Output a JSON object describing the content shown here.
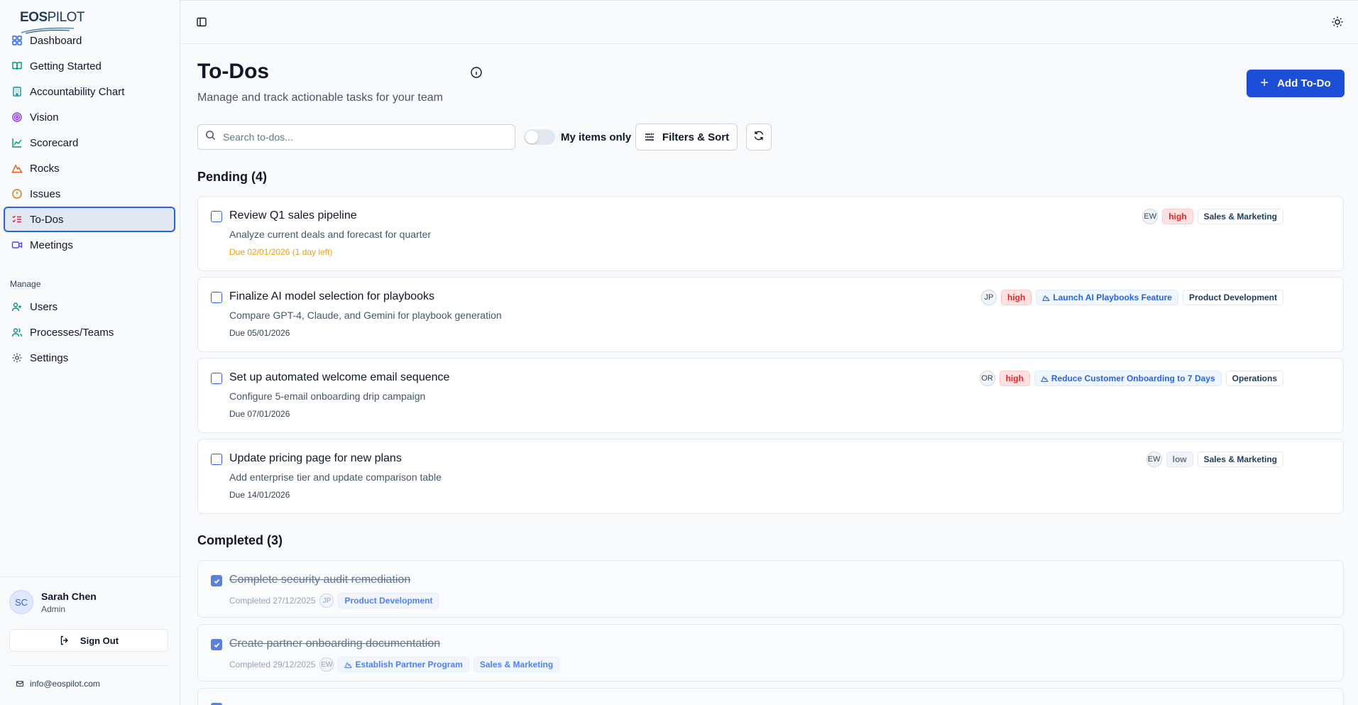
{
  "app": {
    "logo_bold": "EOS",
    "logo_light": "PILOT"
  },
  "sidebar": {
    "items": [
      {
        "label": "Dashboard",
        "icon": "dashboard-icon",
        "color": "#2563eb"
      },
      {
        "label": "Getting Started",
        "icon": "book-open-icon",
        "color": "#059669"
      },
      {
        "label": "Accountability Chart",
        "icon": "building-icon",
        "color": "#0891b2"
      },
      {
        "label": "Vision",
        "icon": "target-icon",
        "color": "#9333ea"
      },
      {
        "label": "Scorecard",
        "icon": "chart-line-icon",
        "color": "#059669"
      },
      {
        "label": "Rocks",
        "icon": "mountain-icon",
        "color": "#ea580c"
      },
      {
        "label": "Issues",
        "icon": "alert-circle-icon",
        "color": "#d97706"
      },
      {
        "label": "To-Dos",
        "icon": "list-todo-icon",
        "color": "#e11d48"
      },
      {
        "label": "Meetings",
        "icon": "video-icon",
        "color": "#4f46e5"
      }
    ],
    "manage_label": "Manage",
    "manage_items": [
      {
        "label": "Users",
        "icon": "users-icon",
        "color": "#0d9488"
      },
      {
        "label": "Processes/Teams",
        "icon": "teams-icon",
        "color": "#0d9488"
      },
      {
        "label": "Settings",
        "icon": "gear-icon",
        "color": "#475569"
      }
    ],
    "user": {
      "initials": "SC",
      "name": "Sarah Chen",
      "role": "Admin"
    },
    "sign_out": "Sign Out",
    "email": "info@eospilot.com"
  },
  "header": {
    "title": "To-Dos",
    "subtitle": "Manage and track actionable tasks for your team",
    "add_button": "Add To-Do"
  },
  "toolbar": {
    "search_placeholder": "Search to-dos...",
    "my_items_label": "My items only",
    "my_items_on": false,
    "filters_label": "Filters & Sort"
  },
  "pending": {
    "heading": "Pending (4)",
    "items": [
      {
        "title": "Review Q1 sales pipeline",
        "description": "Analyze current deals and forecast for quarter",
        "due": "Due 02/01/2026 (1 day left)",
        "due_warning": true,
        "assignee": "EW",
        "priority": "high",
        "rock": "",
        "team": "Sales & Marketing"
      },
      {
        "title": "Finalize AI model selection for playbooks",
        "description": "Compare GPT-4, Claude, and Gemini for playbook generation",
        "due": "Due 05/01/2026",
        "due_warning": false,
        "assignee": "JP",
        "priority": "high",
        "rock": "Launch AI Playbooks Feature",
        "team": "Product Development"
      },
      {
        "title": "Set up automated welcome email sequence",
        "description": "Configure 5-email onboarding drip campaign",
        "due": "Due 07/01/2026",
        "due_warning": false,
        "assignee": "OR",
        "priority": "high",
        "rock": "Reduce Customer Onboarding to 7 Days",
        "team": "Operations"
      },
      {
        "title": "Update pricing page for new plans",
        "description": "Add enterprise tier and update comparison table",
        "due": "Due 14/01/2026",
        "due_warning": false,
        "assignee": "EW",
        "priority": "low",
        "rock": "",
        "team": "Sales & Marketing"
      }
    ]
  },
  "completed": {
    "heading": "Completed (3)",
    "items": [
      {
        "title": "Complete security audit remediation",
        "completed": "Completed 27/12/2025",
        "assignee": "JP",
        "rock": "",
        "team": "Product Development"
      },
      {
        "title": "Create partner onboarding documentation",
        "completed": "Completed 29/12/2025",
        "assignee": "EW",
        "rock": "Establish Partner Program",
        "team": "Sales & Marketing"
      }
    ]
  }
}
